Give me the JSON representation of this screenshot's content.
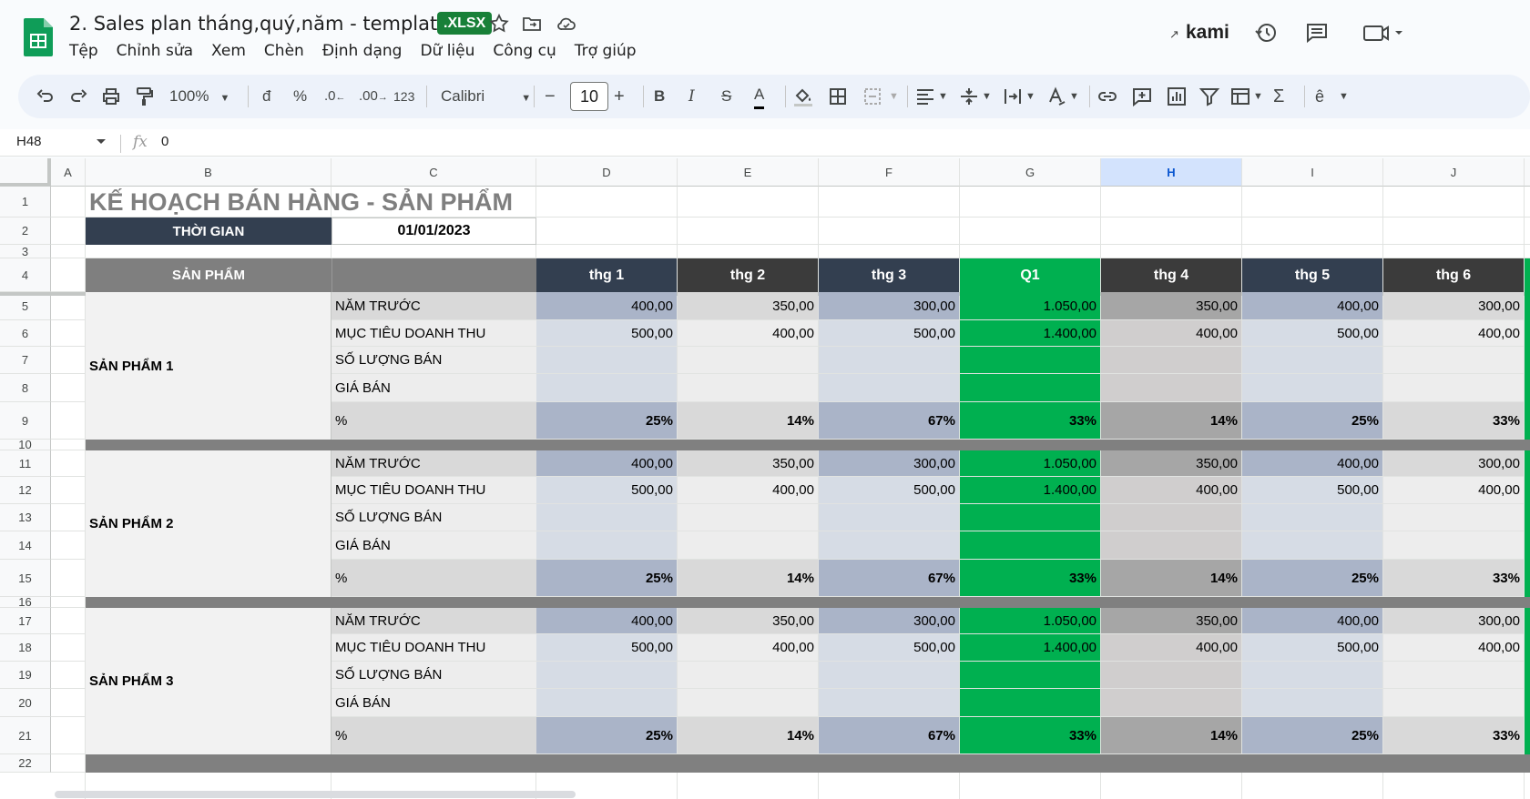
{
  "app": {
    "doc_title": "2. Sales plan tháng,quý,năm - template",
    "badge": ".XLSX",
    "menu": [
      "Tệp",
      "Chỉnh sửa",
      "Xem",
      "Chèn",
      "Định dạng",
      "Dữ liệu",
      "Công cụ",
      "Trợ giúp"
    ],
    "kami": "kami"
  },
  "toolbar": {
    "zoom": "100%",
    "currency": "đ",
    "percent": "%",
    "dec_dec": ".0",
    "dec_inc": ".00",
    "format_123": "123",
    "font": "Calibri",
    "font_size": "10",
    "bold": "B",
    "italic": "I",
    "strike": "S",
    "text_color": "A"
  },
  "formula": {
    "name_box": "H48",
    "fx": "fx",
    "value": "0"
  },
  "columns": [
    "A",
    "B",
    "C",
    "D",
    "E",
    "F",
    "G",
    "H",
    "I",
    "J"
  ],
  "selected_column": "H",
  "colors": {
    "dark_navy": "#333f50",
    "green_q": "#00b050",
    "dark_gray": "#3a3a3a",
    "gray_header": "#7f7f7f",
    "row_blue": "#aab4c8",
    "row_light_blue": "#d6dce5",
    "row_gray": "#d9d9d9",
    "row_light_gray": "#ededed",
    "h_col_dark": "#a6a6a6",
    "h_col_light": "#d0cece"
  },
  "sheet": {
    "title": "KẾ HOẠCH BÁN HÀNG - SẢN PHẨM",
    "time_label": "THỜI GIAN",
    "time_value": "01/01/2023",
    "product_header": "SẢN PHẨM",
    "period_headers": [
      "thg 1",
      "thg 2",
      "thg 3",
      "Q1",
      "thg 4",
      "thg 5",
      "thg 6"
    ],
    "row_labels": [
      "NĂM TRƯỚC",
      "MỤC TIÊU DOANH THU",
      "SỐ LƯỢNG BÁN",
      "GIÁ BÁN",
      "%"
    ],
    "products": [
      {
        "name": "SẢN PHẨM 1",
        "rows": [
          [
            "400,00",
            "350,00",
            "300,00",
            "1.050,00",
            "350,00",
            "400,00",
            "300,00"
          ],
          [
            "500,00",
            "400,00",
            "500,00",
            "1.400,00",
            "400,00",
            "500,00",
            "400,00"
          ],
          [
            "",
            "",
            "",
            "",
            "",
            "",
            ""
          ],
          [
            "",
            "",
            "",
            "",
            "",
            "",
            ""
          ],
          [
            "25%",
            "14%",
            "67%",
            "33%",
            "14%",
            "25%",
            "33%"
          ]
        ]
      },
      {
        "name": "SẢN PHẨM 2",
        "rows": [
          [
            "400,00",
            "350,00",
            "300,00",
            "1.050,00",
            "350,00",
            "400,00",
            "300,00"
          ],
          [
            "500,00",
            "400,00",
            "500,00",
            "1.400,00",
            "400,00",
            "500,00",
            "400,00"
          ],
          [
            "",
            "",
            "",
            "",
            "",
            "",
            ""
          ],
          [
            "",
            "",
            "",
            "",
            "",
            "",
            ""
          ],
          [
            "25%",
            "14%",
            "67%",
            "33%",
            "14%",
            "25%",
            "33%"
          ]
        ]
      },
      {
        "name": "SẢN PHẨM 3",
        "rows": [
          [
            "400,00",
            "350,00",
            "300,00",
            "1.050,00",
            "350,00",
            "400,00",
            "300,00"
          ],
          [
            "500,00",
            "400,00",
            "500,00",
            "1.400,00",
            "400,00",
            "500,00",
            "400,00"
          ],
          [
            "",
            "",
            "",
            "",
            "",
            "",
            ""
          ],
          [
            "",
            "",
            "",
            "",
            "",
            "",
            ""
          ],
          [
            "25%",
            "14%",
            "67%",
            "33%",
            "14%",
            "25%",
            "33%"
          ]
        ]
      }
    ],
    "row_numbers": [
      "1",
      "2",
      "3",
      "4",
      "5",
      "6",
      "7",
      "8",
      "9",
      "10",
      "11",
      "12",
      "13",
      "14",
      "15",
      "16",
      "17",
      "18",
      "19",
      "20",
      "21",
      "22"
    ]
  }
}
